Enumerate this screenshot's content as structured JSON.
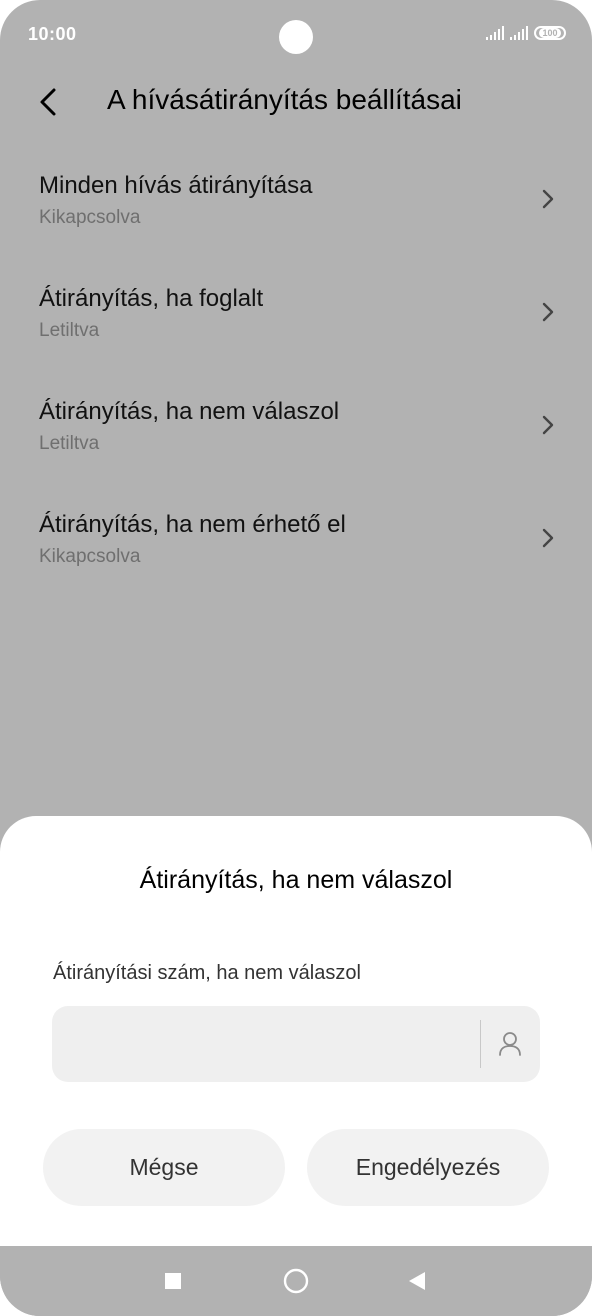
{
  "status": {
    "time": "10:00",
    "battery": "100"
  },
  "header": {
    "title": "A hívásátirányítás beállításai"
  },
  "list": [
    {
      "title": "Minden hívás átirányítása",
      "subtitle": "Kikapcsolva"
    },
    {
      "title": "Átirányítás, ha foglalt",
      "subtitle": "Letiltva"
    },
    {
      "title": "Átirányítás, ha nem válaszol",
      "subtitle": "Letiltva"
    },
    {
      "title": "Átirányítás, ha nem érhető el",
      "subtitle": "Kikapcsolva"
    }
  ],
  "dialog": {
    "title": "Átirányítás, ha nem válaszol",
    "field_label": "Átirányítási szám, ha nem válaszol",
    "field_value": "",
    "cancel_label": "Mégse",
    "enable_label": "Engedélyezés"
  },
  "colors": {
    "dim_background": "#b2b2b2",
    "sheet": "#ffffff",
    "input_bg": "#efefef",
    "button_bg": "#f2f2f2"
  },
  "icons": [
    "back-arrow-icon",
    "chevron-right-icon",
    "contact-person-icon",
    "signal-icon",
    "battery-icon",
    "nav-recents-icon",
    "nav-home-icon",
    "nav-back-icon"
  ]
}
